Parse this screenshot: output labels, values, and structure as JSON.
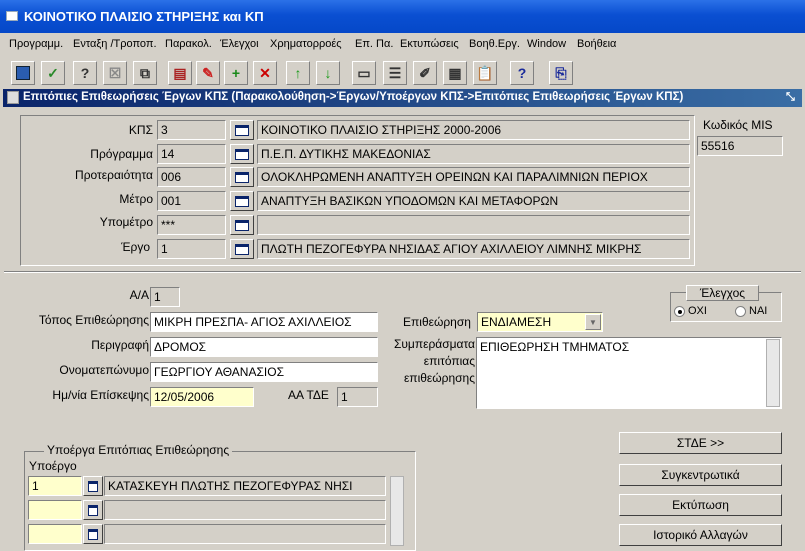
{
  "window": {
    "title": "ΚΟΙΝΟΤΙΚΟ ΠΛΑΙΣΙΟ ΣΤΗΡΙΞΗΣ και ΚΠ"
  },
  "menu": [
    "Προγραμμ.",
    "Ενταξη /Τροποπ.",
    "Παρακολ.",
    "Έλεγχοι",
    "Χρηματορροές",
    "Επ. Πα.",
    "Εκτυπώσεις",
    "Βοηθ.Εργ.",
    "Window",
    "Βοήθεια"
  ],
  "toolbar_icons": [
    "save-icon",
    "accept-icon",
    "query-icon",
    "cancel-query-icon",
    "copy-icon",
    "edit-icon",
    "clear-icon",
    "insert-record-icon",
    "delete-record-icon",
    "previous-record-icon",
    "next-record-icon",
    "print-icon",
    "list-icon",
    "form-icon",
    "report-icon",
    "paste-icon",
    "help-icon",
    "exit-icon"
  ],
  "form": {
    "title": "Επιτόπιες Επιθεωρήσεις Έργων ΚΠΣ (Παρακολούθηση->Έργων/Υποέργων ΚΠΣ->Επιτόπιες Επιθεωρήσεις Έργων ΚΠΣ)",
    "header": {
      "kps_label": "ΚΠΣ",
      "kps_code": "3",
      "kps_desc": "ΚΟΙΝΟΤΙΚΟ ΠΛΑΙΣΙΟ ΣΤΗΡΙΞΗΣ 2000-2006",
      "programma_label": "Πρόγραμμα",
      "programma_code": "14",
      "programma_desc": "Π.Ε.Π. ΔΥΤΙΚΗΣ ΜΑΚΕΔΟΝΙΑΣ",
      "proteraiotita_label": "Προτεραιότητα",
      "proteraiotita_code": "006",
      "proteraiotita_desc": "ΟΛΟΚΛΗΡΩΜΕΝΗ ΑΝΑΠΤΥΞΗ ΟΡΕΙΝΩΝ ΚΑΙ ΠΑΡΑΛΙΜΝΙΩΝ ΠΕΡΙΟΧ",
      "metro_label": "Μέτρο",
      "metro_code": "001",
      "metro_desc": "ΑΝΑΠΤΥΞΗ ΒΑΣΙΚΩΝ ΥΠΟΔΟΜΩΝ ΚΑΙ ΜΕΤΑΦΟΡΩΝ",
      "ypometro_label": "Υπομέτρο",
      "ypometro_code": "***",
      "ypometro_desc": "",
      "ergo_label": "Έργο",
      "ergo_code": "1",
      "ergo_desc": "ΠΛΩΤΗ ΠΕΖΟΓΕΦΥΡΑ ΝΗΣΙΔΑΣ ΑΓΙΟΥ ΑΧΙΛΛΕΙΟΥ ΛΙΜΝΗΣ ΜΙΚΡΗΣ",
      "mis_label": "Κωδικός MIS",
      "mis_value": "55516"
    },
    "inspection": {
      "aa_label": "Α/Α",
      "aa_value": "1",
      "topos_label": "Τόπος Επιθεώρησης",
      "topos_value": "ΜΙΚΡΗ ΠΡΕΣΠΑ- ΑΓΙΟΣ ΑΧΙΛΛΕΙΟΣ",
      "perigrafi_label": "Περιγραφή",
      "perigrafi_value": "ΔΡΟΜΟΣ",
      "onomateponymo_label": "Ονοματεπώνυμο",
      "onomateponymo_value": "ΓΕΩΡΓΙΟΥ ΑΘΑΝΑΣΙΟΣ",
      "date_label": "Ημ/νία Επίσκεψης",
      "date_value": "12/05/2006",
      "aa_tde_label": "ΑΑ ΤΔΕ",
      "aa_tde_value": "1",
      "epitheorisi_label": "Επιθεώρηση",
      "epitheorisi_value": "ΕΝΔΙΑΜΕΣΗ",
      "symperasmata_label_1": "Συμπεράσματα",
      "symperasmata_label_2": "επιτόπιας",
      "symperasmata_label_3": "επιθεώρησης",
      "symperasmata_value": "ΕΠΙΘΕΩΡΗΣΗ ΤΜΗΜΑΤΟΣ",
      "elegxos_label": "Έλεγχος",
      "elegxos_no": "ΟΧΙ",
      "elegxos_yes": "ΝΑΙ"
    },
    "subprojects": {
      "group_label": "Υποέργα Επιτόπιας Επιθεώρησης",
      "col_label": "Υποέργο",
      "rows": [
        {
          "code": "1",
          "desc": "ΚΑΤΑΣΚΕΥΗ ΠΛΩΤΗΣ ΠΕΖΟΓΕΦΥΡΑΣ ΝΗΣΙ"
        },
        {
          "code": "",
          "desc": ""
        },
        {
          "code": "",
          "desc": ""
        }
      ]
    },
    "buttons": {
      "stde": "ΣΤΔΕ >>",
      "synkentrotika": "Συγκεντρωτικά",
      "ektyposi": "Εκτύπωση",
      "istoriko": "Ιστορικό Αλλαγών"
    }
  }
}
